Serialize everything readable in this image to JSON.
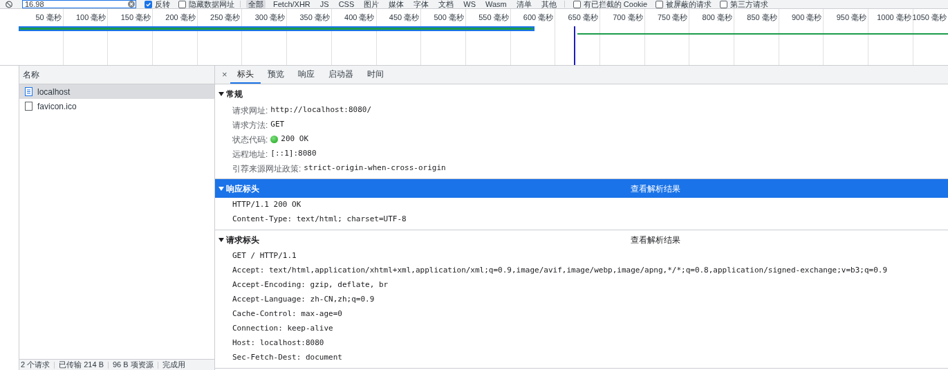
{
  "toolbar": {
    "filter": {
      "value": "16.98"
    },
    "options": [
      {
        "label": "反转",
        "checked": true
      },
      {
        "label": "隐藏数据网址",
        "checked": false
      }
    ],
    "types": [
      {
        "label": "全部",
        "selected": true
      },
      {
        "label": "Fetch/XHR",
        "selected": false
      },
      {
        "label": "JS",
        "selected": false
      },
      {
        "label": "CSS",
        "selected": false
      },
      {
        "label": "图片",
        "selected": false
      },
      {
        "label": "媒体",
        "selected": false
      },
      {
        "label": "字体",
        "selected": false
      },
      {
        "label": "文档",
        "selected": false
      },
      {
        "label": "WS",
        "selected": false
      },
      {
        "label": "Wasm",
        "selected": false
      },
      {
        "label": "清单",
        "selected": false
      },
      {
        "label": "其他",
        "selected": false
      }
    ],
    "extra_options": [
      {
        "label": "有已拦截的 Cookie",
        "checked": false
      },
      {
        "label": "被屏蔽的请求",
        "checked": false
      },
      {
        "label": "第三方请求",
        "checked": false
      }
    ]
  },
  "timeline": {
    "ticks": [
      "50 毫秒",
      "100 毫秒",
      "150 毫秒",
      "200 毫秒",
      "250 毫秒",
      "300 毫秒",
      "350 毫秒",
      "400 毫秒",
      "450 毫秒",
      "500 毫秒",
      "550 毫秒",
      "600 毫秒",
      "650 毫秒",
      "700 毫秒",
      "750 毫秒",
      "800 毫秒",
      "850 毫秒",
      "900 毫秒",
      "950 毫秒",
      "1000 毫秒",
      "1050 毫秒"
    ]
  },
  "requests": {
    "header": "名称",
    "items": [
      {
        "name": "localhost",
        "kind": "document",
        "selected": true
      },
      {
        "name": "favicon.ico",
        "kind": "other",
        "selected": false
      }
    ]
  },
  "status_bar": [
    "2 个请求",
    "已传输 214 B",
    "96 B 项资源",
    "完成用"
  ],
  "details": {
    "close": "×",
    "tabs": [
      {
        "label": "标头",
        "selected": true
      },
      {
        "label": "预览",
        "selected": false
      },
      {
        "label": "响应",
        "selected": false
      },
      {
        "label": "启动器",
        "selected": false
      },
      {
        "label": "时间",
        "selected": false
      }
    ],
    "sections": [
      {
        "title": "常规",
        "expanded": true,
        "selected": false,
        "rows": [
          {
            "kind": "field",
            "label": "请求网址:",
            "value": "http://localhost:8080/"
          },
          {
            "kind": "field",
            "label": "请求方法:",
            "value": "GET"
          },
          {
            "kind": "status",
            "label": "状态代码:",
            "value": "200 OK"
          },
          {
            "kind": "field",
            "label": "远程地址:",
            "value": "[::1]:8080"
          },
          {
            "kind": "field",
            "label": "引荐来源网址政策:",
            "value": "strict-origin-when-cross-origin"
          }
        ]
      },
      {
        "title": "响应标头",
        "expanded": true,
        "selected": true,
        "action": "查看解析结果",
        "rows": [
          {
            "kind": "line",
            "value": "HTTP/1.1 200 OK"
          },
          {
            "kind": "line",
            "value": "Content-Type: text/html; charset=UTF-8"
          }
        ]
      },
      {
        "title": "请求标头",
        "expanded": true,
        "selected": false,
        "action": "查看解析结果",
        "rows": [
          {
            "kind": "line",
            "value": "GET / HTTP/1.1"
          },
          {
            "kind": "line",
            "value": "Accept: text/html,application/xhtml+xml,application/xml;q=0.9,image/avif,image/webp,image/apng,*/*;q=0.8,application/signed-exchange;v=b3;q=0.9"
          },
          {
            "kind": "line",
            "value": "Accept-Encoding: gzip, deflate, br"
          },
          {
            "kind": "line",
            "value": "Accept-Language: zh-CN,zh;q=0.9"
          },
          {
            "kind": "line",
            "value": "Cache-Control: max-age=0"
          },
          {
            "kind": "line",
            "value": "Connection: keep-alive"
          },
          {
            "kind": "line",
            "value": "Host: localhost:8080"
          },
          {
            "kind": "line",
            "value": "Sec-Fetch-Dest: document"
          }
        ]
      }
    ]
  }
}
